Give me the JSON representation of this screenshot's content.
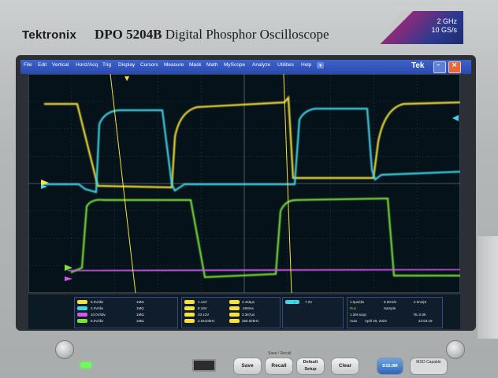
{
  "device": {
    "brand": "Tektronix",
    "model_bold": "DPO 5204B",
    "model_rest": " Digital Phosphor Oscilloscope",
    "spec_line1": "2 GHz",
    "spec_line2": "10 GS/s"
  },
  "menubar": {
    "items": [
      "File",
      "Edit",
      "Vertical",
      "Horiz/Acq",
      "Trig",
      "Display",
      "Cursors",
      "Measure",
      "Mask",
      "Math",
      "MyScope",
      "Analyze",
      "Utilities",
      "Help"
    ],
    "logo": "Tek"
  },
  "channels": [
    {
      "label": "5.0V/div",
      "color": "#f6e23a"
    },
    {
      "label": "2.0V/div",
      "color": "#3fd7ea"
    },
    {
      "label": "10.0V/div",
      "color": "#d05ae8"
    },
    {
      "label": "5.0V/div",
      "color": "#7be23a"
    }
  ],
  "impedance": [
    "1MΩ",
    "1MΩ",
    "1MΩ",
    "1MΩ"
  ],
  "measurements": {
    "col1": [
      "1.14V",
      "8.18V",
      "10.12V",
      "2.6410kHz"
    ],
    "col2": [
      "4.440µs",
      ".608ms",
      "3.367µs",
      "255.82kHz"
    ]
  },
  "trigger_level": "7.2V",
  "horizontal": {
    "scale": "1.0µs/div",
    "rate": "5.0GS/s",
    "point": "2.0ns/pt",
    "mode": "Run",
    "sample": "Sample",
    "record": "1.2M acqs",
    "rl": "RL:5.0k",
    "auto": "Auto",
    "date": "April 20, 2023",
    "time": "22:53:19"
  },
  "front_panel": {
    "buttons": [
      "Save",
      "Recall",
      "Default Setup",
      "Clear",
      "D15.0M"
    ],
    "caption": "Save / Recall",
    "sticker": "MSO Capable"
  },
  "colors": {
    "ch1": "#f6e23a",
    "ch2": "#3fd7ea",
    "ch3": "#d05ae8",
    "ch4": "#7be23a",
    "menubar": "#2a4ab0"
  }
}
